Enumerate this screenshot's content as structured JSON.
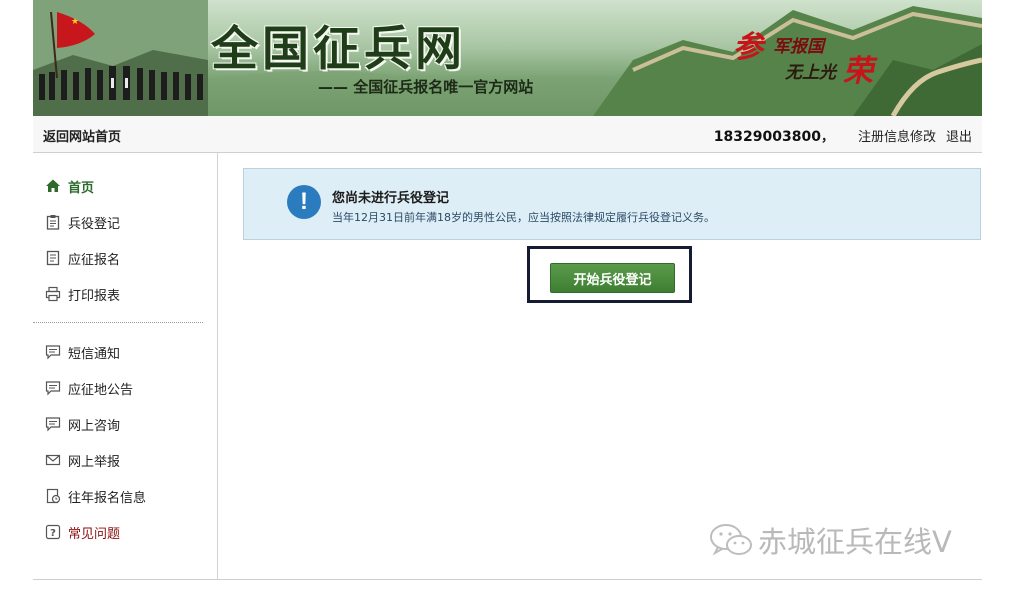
{
  "banner": {
    "title": "全国征兵网",
    "subtitle": "—— 全国征兵报名唯一官方网站",
    "slogan": {
      "char1": "参",
      "line1": "军报国",
      "line2": "无上光",
      "char2": "荣"
    }
  },
  "topbar": {
    "home_link": "返回网站首页",
    "phone": "18329003800",
    "comma": "，",
    "edit_link": "注册信息修改",
    "logout_link": "退出"
  },
  "sidebar": {
    "items": [
      {
        "label": "首页",
        "icon": "home-icon"
      },
      {
        "label": "兵役登记",
        "icon": "clipboard-icon"
      },
      {
        "label": "应征报名",
        "icon": "document-icon"
      },
      {
        "label": "打印报表",
        "icon": "printer-icon"
      },
      {
        "label": "短信通知",
        "icon": "message-icon"
      },
      {
        "label": "应征地公告",
        "icon": "message-icon"
      },
      {
        "label": "网上咨询",
        "icon": "message-icon"
      },
      {
        "label": "网上举报",
        "icon": "mail-icon"
      },
      {
        "label": "往年报名信息",
        "icon": "history-document-icon"
      },
      {
        "label": "常见问题",
        "icon": "question-icon"
      }
    ]
  },
  "notice": {
    "title": "您尚未进行兵役登记",
    "text": "当年12月31日前年满18岁的男性公民，应当按照法律规定履行兵役登记义务。",
    "icon_char": "!"
  },
  "start_button": {
    "label": "开始兵役登记"
  },
  "watermark": {
    "text": "赤城征兵在线V"
  },
  "colors": {
    "accent_green": "#3f7f33",
    "notice_bg": "#deeef6",
    "info_blue": "#2b7bbf",
    "warn_red": "#8a0f0f"
  }
}
